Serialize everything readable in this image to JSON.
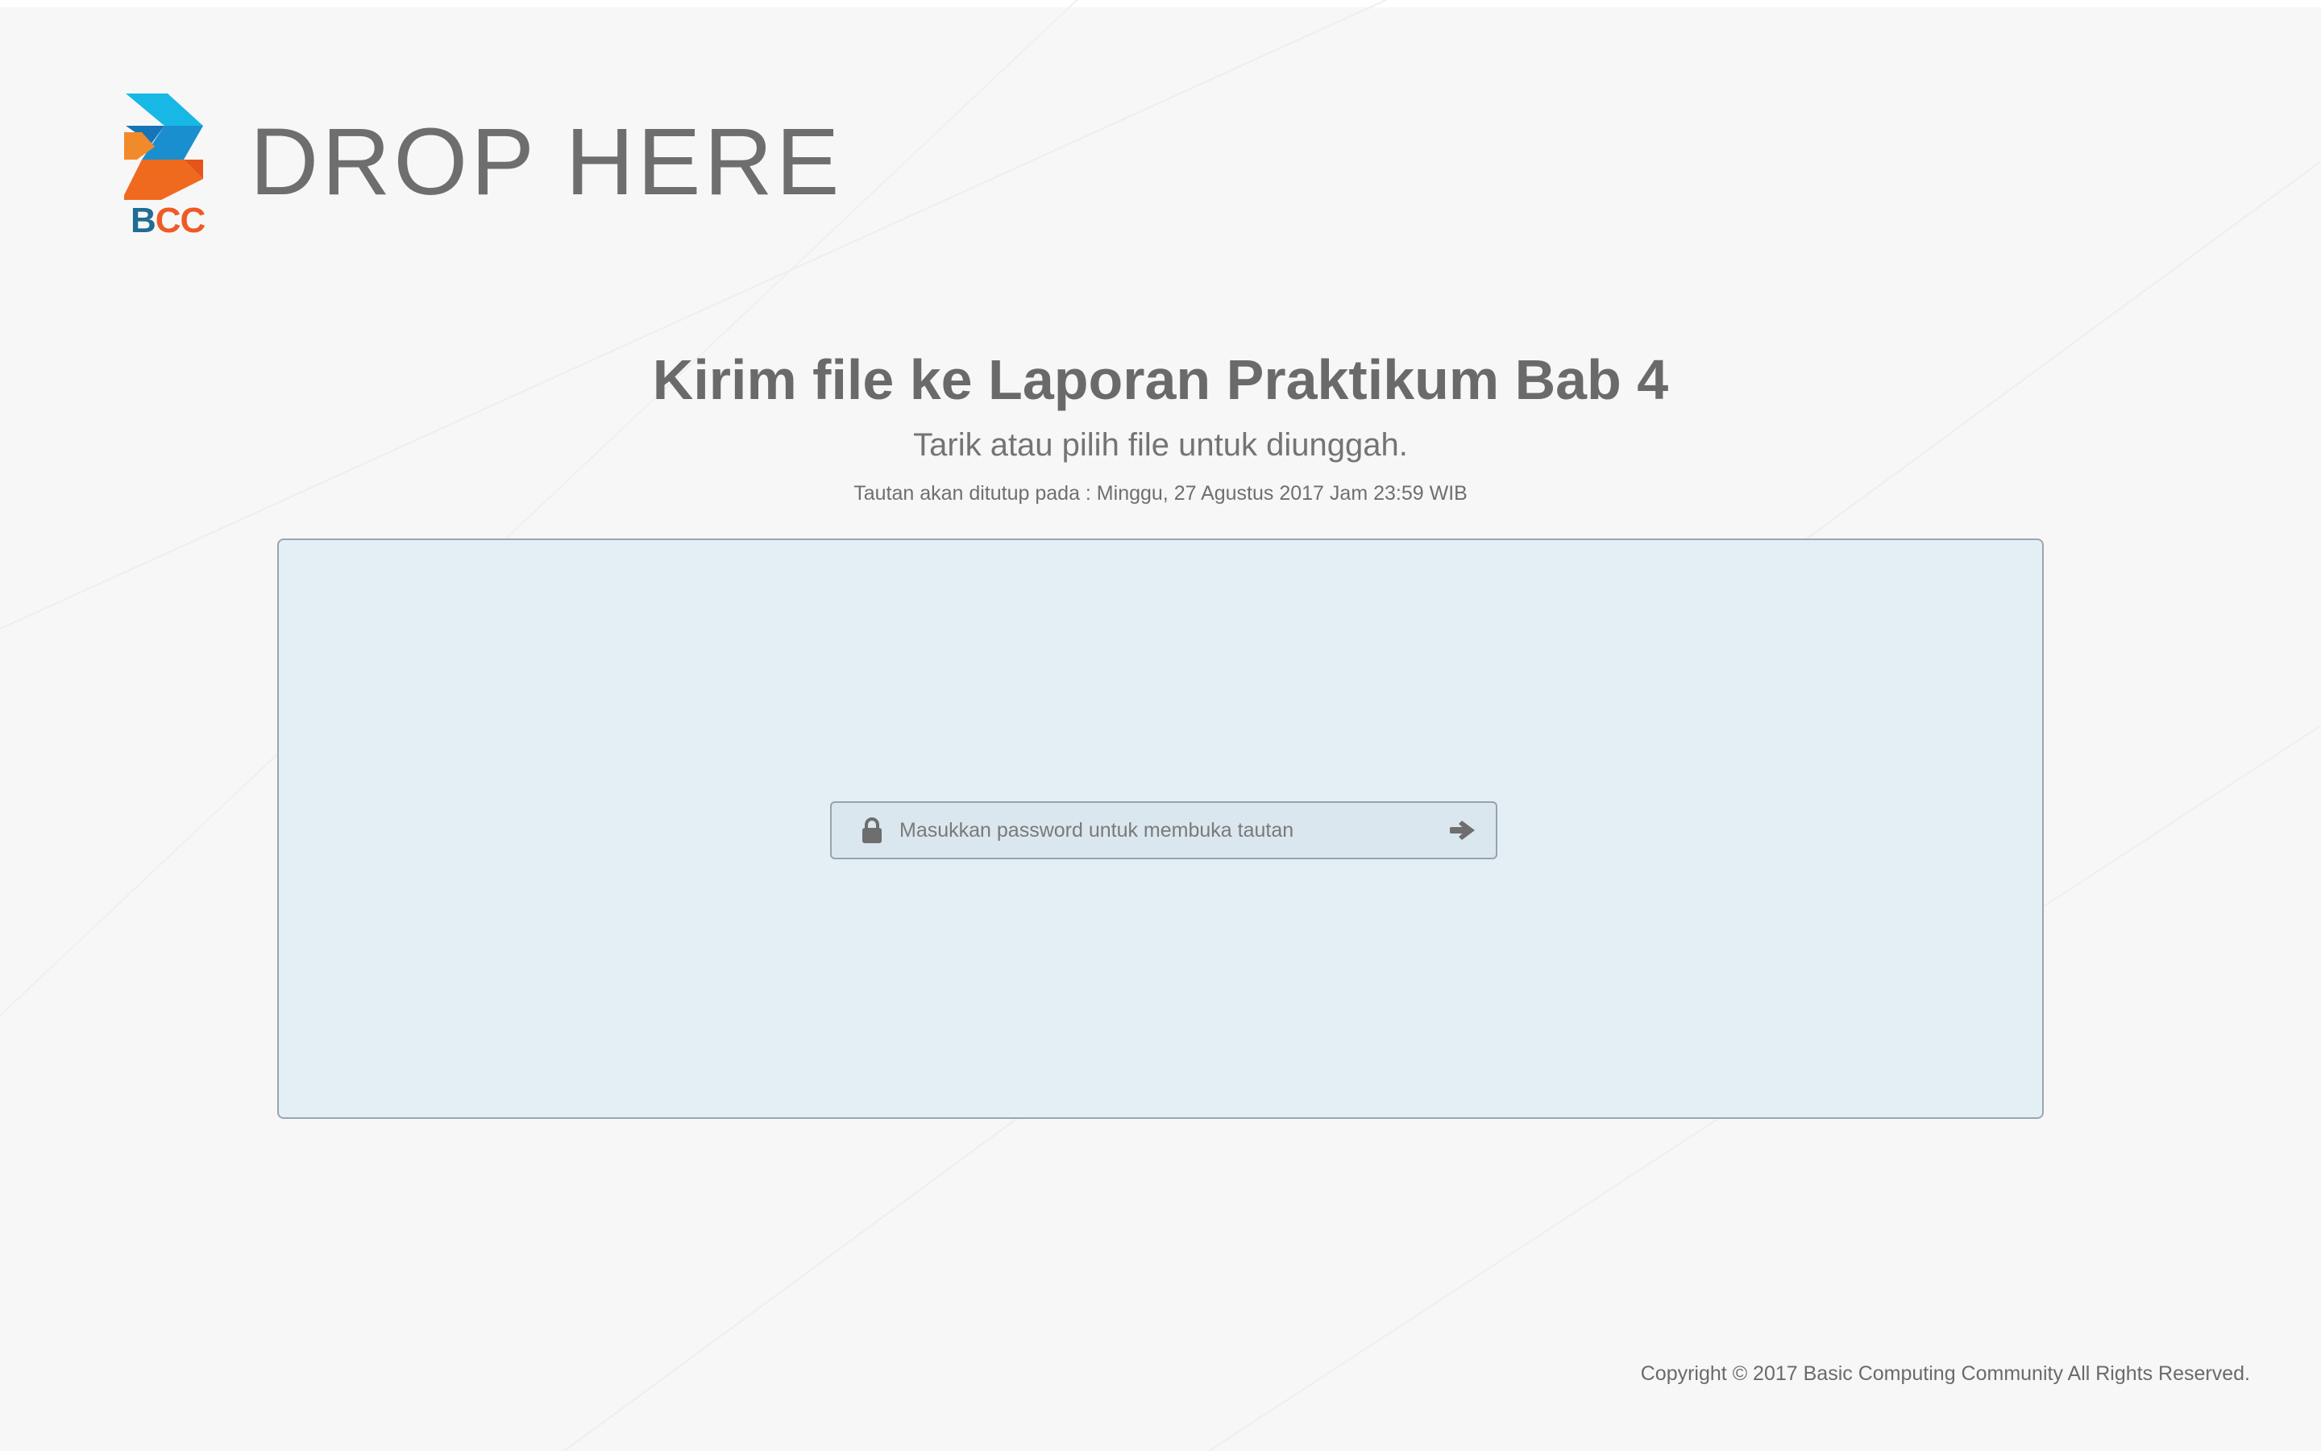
{
  "app": {
    "brand_title": "DROP HERE",
    "logo": {
      "text_b": "B",
      "text_cc": "CC",
      "colors": {
        "blue": "#1ba6d9",
        "dark_blue": "#1f6d94",
        "orange": "#ef6a1f"
      }
    }
  },
  "main": {
    "title": "Kirim file ke  Laporan Praktikum Bab 4",
    "subtitle": "Tarik atau pilih file untuk diunggah.",
    "deadline": "Tautan akan ditutup pada : Minggu, 27 Agustus 2017 Jam 23:59 WIB"
  },
  "password": {
    "icon": "lock-icon",
    "placeholder": "Masukkan password untuk membuka tautan",
    "value": "",
    "submit_icon": "arrow-right-icon"
  },
  "footer": {
    "copyright": "Copyright © 2017 Basic Computing Community All Rights Reserved."
  },
  "colors": {
    "background": "#f7f7f7",
    "dropzone_bg": "#e4eff5",
    "dropzone_border": "#9aa6ad",
    "text": "#6b6b6b"
  }
}
